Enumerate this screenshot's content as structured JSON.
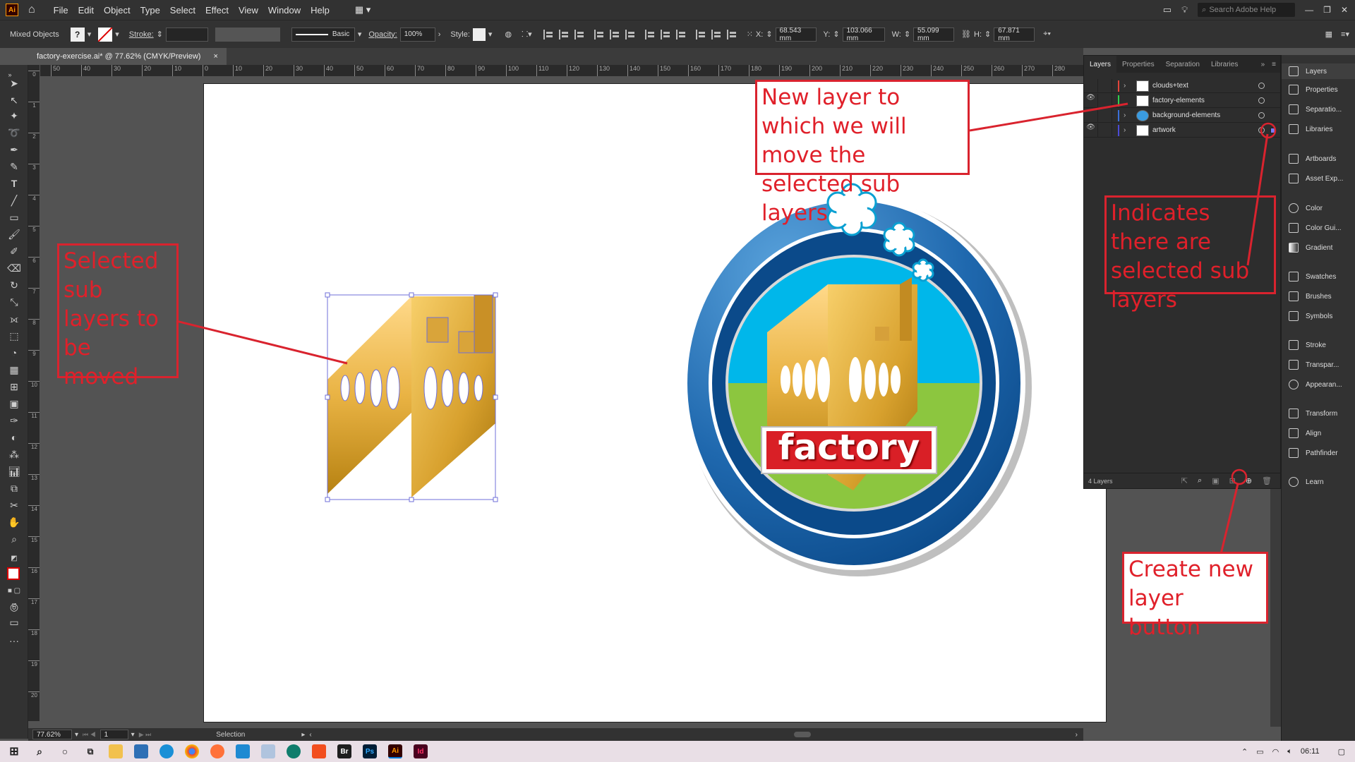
{
  "app": {
    "logo": "Ai",
    "search_placeholder": "Search Adobe Help"
  },
  "menu": [
    "File",
    "Edit",
    "Object",
    "Type",
    "Select",
    "Effect",
    "View",
    "Window",
    "Help"
  ],
  "control": {
    "selection_type": "Mixed Objects",
    "fill_label": "?",
    "stroke_label": "Stroke:",
    "brush": "Basic",
    "opacity_label": "Opacity:",
    "opacity_value": "100%",
    "style_label": "Style:",
    "x_label": "X:",
    "x_value": "68.543 mm",
    "y_label": "Y:",
    "y_value": "103.066 mm",
    "w_label": "W:",
    "w_value": "55.099 mm",
    "h_label": "H:",
    "h_value": "67.871 mm"
  },
  "document": {
    "tab_title": "factory-exercise.ai* @ 77.62% (CMYK/Preview)",
    "close": "×"
  },
  "ruler_h": [
    "50",
    "40",
    "30",
    "20",
    "10",
    "0",
    "10",
    "20",
    "30",
    "40",
    "50",
    "60",
    "70",
    "80",
    "90",
    "100",
    "110",
    "120",
    "130",
    "140",
    "150",
    "160",
    "170",
    "180",
    "190",
    "200",
    "210",
    "220",
    "230",
    "240",
    "250",
    "260",
    "270",
    "280"
  ],
  "ruler_v": [
    "0",
    "1",
    "2",
    "3",
    "4",
    "5",
    "6",
    "7",
    "8",
    "9",
    "10",
    "11",
    "12",
    "13",
    "14",
    "15",
    "16",
    "17",
    "18",
    "19",
    "20"
  ],
  "status": {
    "zoom": "77.62%",
    "artboard": "1",
    "tool": "Selection"
  },
  "panel": {
    "tabs": [
      "Layers",
      "Properties",
      "Separation",
      "Libraries"
    ],
    "layers": [
      {
        "name": "clouds+text",
        "color": "#e2453a",
        "visible": false
      },
      {
        "name": "factory-elements",
        "color": "#2fd14e",
        "visible": true
      },
      {
        "name": "background-elements",
        "color": "#3b6fd8",
        "visible": false
      },
      {
        "name": "artwork",
        "color": "#4b4bd6",
        "visible": true
      }
    ],
    "count": "4 Layers"
  },
  "dock": [
    "Layers",
    "Properties",
    "Separatio...",
    "Libraries",
    "Artboards",
    "Asset Exp...",
    "Color",
    "Color Gui...",
    "Gradient",
    "Swatches",
    "Brushes",
    "Symbols",
    "Stroke",
    "Transpar...",
    "Appearan...",
    "Transform",
    "Align",
    "Pathfinder",
    "Learn"
  ],
  "logo_text": "factory",
  "annotations": {
    "new_layer": "New layer to which we will move the selected sub layers",
    "indicates": "Indicates there are selected sub layers",
    "selected": "Selected sub layers to be moved",
    "create": "Create new layer button"
  },
  "taskbar": {
    "time": "06:11"
  },
  "colors": {
    "annotation": "#d9232e",
    "sky": "#00b7ea",
    "grass": "#8cc63f",
    "ring_dark": "#0b4a8a",
    "ring_light": "#3a87c8",
    "factory_gold": "#e8b54a",
    "banner_red": "#d91f26"
  }
}
